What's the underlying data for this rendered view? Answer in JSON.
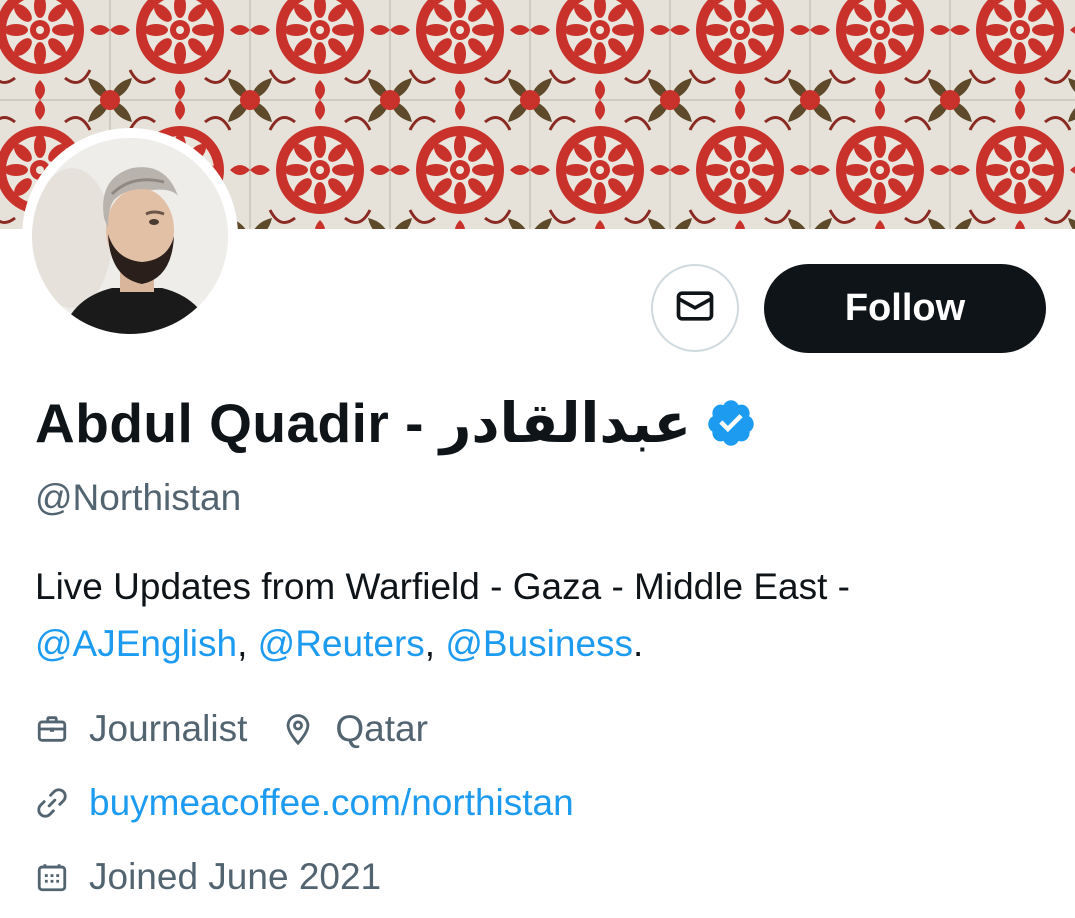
{
  "profile": {
    "display_name": "Abdul Quadir - عبدالقادر",
    "handle": "@Northistan",
    "verified_icon": "verified-badge-icon",
    "bio": {
      "text_line1": "Live Updates from Warfield - Gaza - Middle East -",
      "mentions": [
        "@AJEnglish",
        "@Reuters",
        "@Business"
      ],
      "sep1": ", ",
      "sep2": ", ",
      "end": "."
    },
    "profession": "Journalist",
    "location": "Qatar",
    "website": "buymeacoffee.com/northistan",
    "joined": "Joined June 2021"
  },
  "actions": {
    "message_icon": "envelope-icon",
    "follow_label": "Follow"
  },
  "colors": {
    "accent": "#1d9bf0",
    "text_primary": "#0f1419",
    "text_secondary": "#536471",
    "follow_bg": "#0f1419",
    "border": "#cfd9de",
    "banner_red": "#c8322a",
    "banner_cream": "#e8e4dc"
  }
}
